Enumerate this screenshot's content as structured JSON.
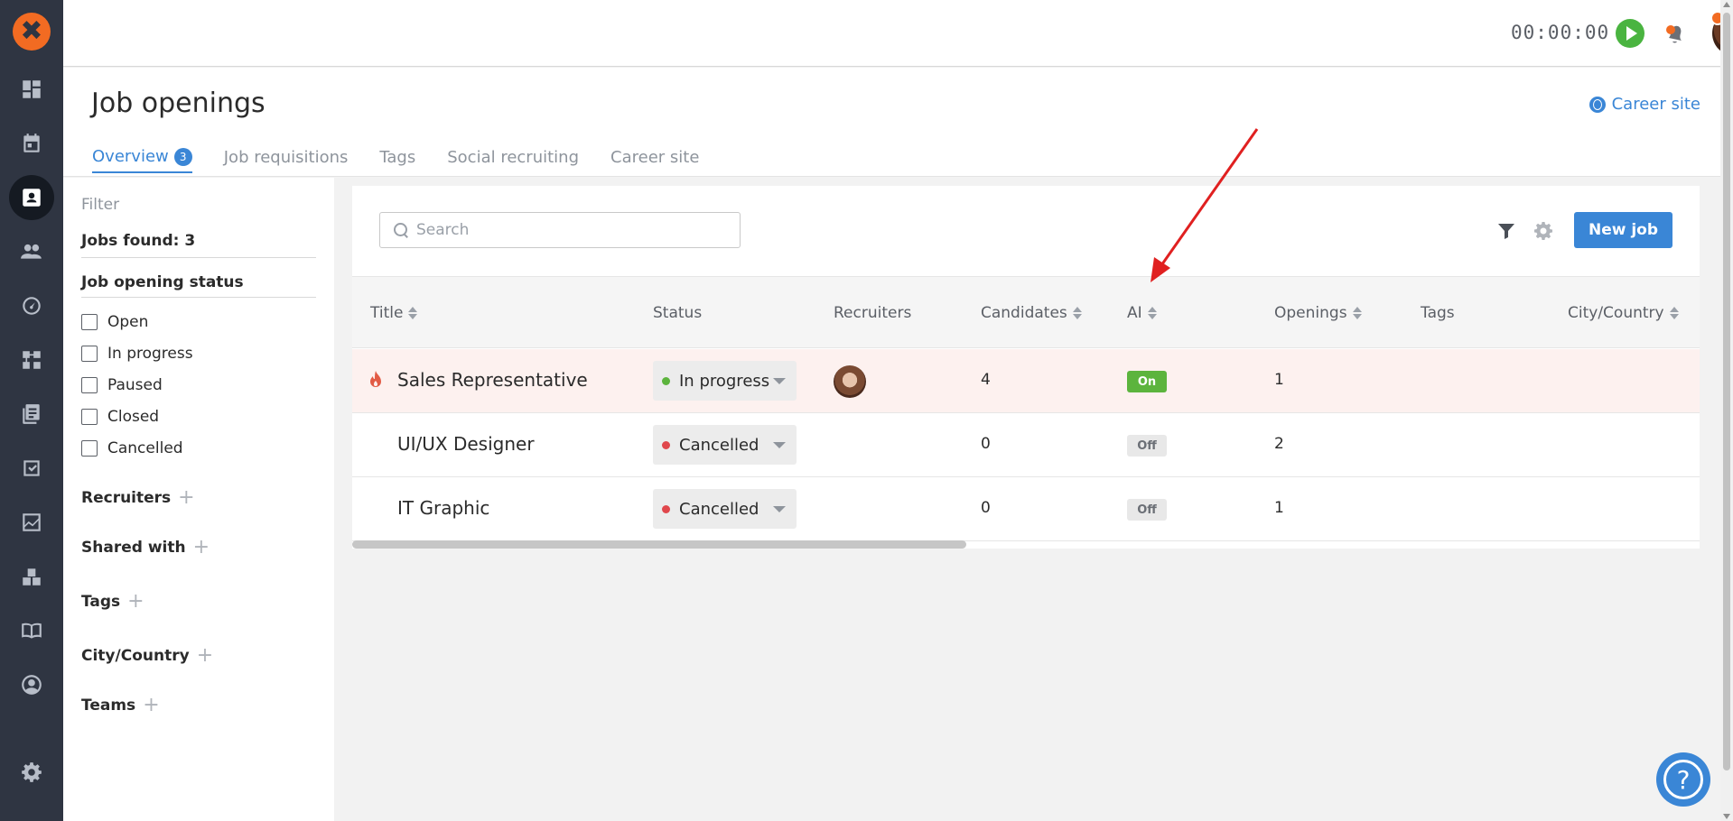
{
  "rail": {
    "logo_glyph": "✖",
    "items": [
      {
        "icon": "dashboard-icon"
      },
      {
        "icon": "calendar-icon"
      },
      {
        "icon": "job-openings-icon",
        "active": true
      },
      {
        "icon": "candidates-icon"
      },
      {
        "icon": "speedometer-icon"
      },
      {
        "icon": "workflow-icon"
      },
      {
        "icon": "documents-icon"
      },
      {
        "icon": "tasks-icon"
      },
      {
        "icon": "reports-icon"
      },
      {
        "icon": "integrations-icon"
      },
      {
        "icon": "knowledge-book-icon"
      },
      {
        "icon": "profile-icon"
      },
      {
        "icon": "settings-icon"
      }
    ]
  },
  "topbar": {
    "timer": "00:00:00",
    "help_glyph": "?"
  },
  "page": {
    "title": "Job openings",
    "career_site_link": "Career site",
    "tabs": [
      {
        "label": "Overview",
        "count": "3",
        "active": true
      },
      {
        "label": "Job requisitions"
      },
      {
        "label": "Tags"
      },
      {
        "label": "Social recruiting"
      },
      {
        "label": "Career site"
      }
    ]
  },
  "sidebar": {
    "filter_title": "Filter",
    "jobs_found": "Jobs found: 3",
    "status_title": "Job opening status",
    "statuses": [
      "Open",
      "In progress",
      "Paused",
      "Closed",
      "Cancelled"
    ],
    "groups": [
      "Recruiters",
      "Shared with",
      "Tags",
      "City/Country",
      "Teams"
    ],
    "plus_glyph": "+"
  },
  "toolbar": {
    "search_placeholder": "Search",
    "new_job_label": "New job"
  },
  "table": {
    "columns": [
      "Title",
      "Status",
      "Recruiters",
      "Candidates",
      "AI",
      "Openings",
      "Tags",
      "City/Country"
    ],
    "rows": [
      {
        "title": "Sales Representative",
        "hot": true,
        "status": "In progress",
        "status_color": "#5cb43d",
        "has_recruiter": true,
        "candidates": "4",
        "ai": "On",
        "openings": "1"
      },
      {
        "title": "UI/UX Designer",
        "hot": false,
        "status": "Cancelled",
        "status_color": "#e0474c",
        "has_recruiter": false,
        "candidates": "0",
        "ai": "Off",
        "openings": "2"
      },
      {
        "title": "IT Graphic",
        "hot": false,
        "status": "Cancelled",
        "status_color": "#e0474c",
        "has_recruiter": false,
        "candidates": "0",
        "ai": "Off",
        "openings": "1"
      }
    ]
  },
  "colors": {
    "accent": "#3a86d6",
    "brand": "#f26b22",
    "rail_bg": "#2f3542",
    "annotation_arrow": "#e02020"
  }
}
